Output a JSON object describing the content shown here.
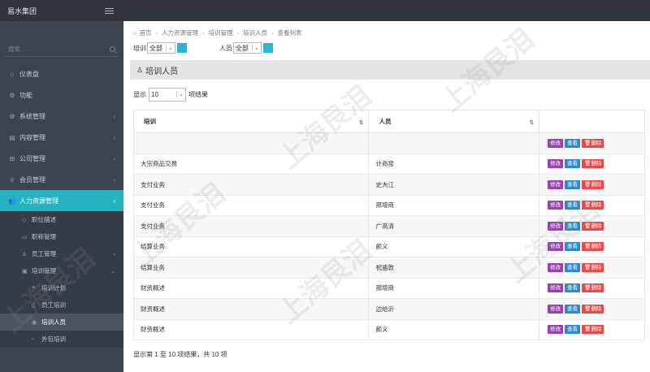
{
  "app": {
    "title": "易水集团"
  },
  "sidebar": {
    "search_placeholder": "搜索...",
    "items": [
      {
        "label": "仪表盘",
        "icon": "home-icon"
      },
      {
        "label": "功能",
        "icon": "gear-icon"
      },
      {
        "label": "系统管理",
        "icon": "cogs-icon"
      },
      {
        "label": "内容管理",
        "icon": "list-icon"
      },
      {
        "label": "公司管理",
        "icon": "sitemap-icon"
      },
      {
        "label": "会员管理",
        "icon": "trophy-icon"
      },
      {
        "label": "人力资源管理",
        "icon": "users-icon"
      }
    ],
    "hr_sub": [
      {
        "label": "职位描述"
      },
      {
        "label": "职称管理"
      },
      {
        "label": "员工管理"
      },
      {
        "label": "培训管理"
      }
    ],
    "training_sub": [
      {
        "label": "培训计划"
      },
      {
        "label": "员工培训"
      },
      {
        "label": "培训人员"
      },
      {
        "label": "外包培训"
      }
    ]
  },
  "breadcrumb": [
    "首页",
    "人力资源管理",
    "培训管理",
    "培训人员",
    "查看列表"
  ],
  "filters": {
    "training_label": "培训",
    "training_value": "全部",
    "person_label": "人员",
    "person_value": "全部"
  },
  "panel": {
    "title": "培训人员"
  },
  "length": {
    "prefix": "显示",
    "value": "10",
    "suffix": "项结果"
  },
  "table": {
    "headers": [
      "培训",
      "人员"
    ],
    "rows": [
      [
        "",
        ""
      ],
      [
        "大宗商品交易",
        "计商窑"
      ],
      [
        "支付业务",
        "史大江"
      ],
      [
        "支付业务",
        "邢增商"
      ],
      [
        "支付业务",
        "广高清"
      ],
      [
        "结算业务",
        "颜义"
      ],
      [
        "结算业务",
        "祝骆敦"
      ],
      [
        "财资概述",
        "邢增商"
      ],
      [
        "财资概述",
        "边给沂"
      ],
      [
        "财资概述",
        "颜义"
      ]
    ],
    "actions": {
      "edit": "修改",
      "view": "查看",
      "delete": "删除"
    }
  },
  "footer": "显示第 1 至 10 项结果，共 10 项",
  "watermark": "上海艮泪"
}
